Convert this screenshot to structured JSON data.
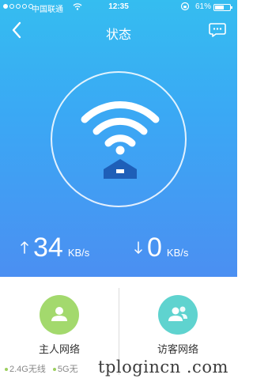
{
  "status_bar": {
    "carrier": "中国联通",
    "time": "12:35",
    "battery": "61%",
    "battery_level": 0.61
  },
  "nav": {
    "title": "状态",
    "back_icon": "chevron-left-icon",
    "chat_icon": "chat-bubble-icon"
  },
  "wifi_status": {
    "icon": "wifi-router-icon"
  },
  "speeds": {
    "upload_value": "34",
    "upload_unit": "KB/s",
    "download_value": "0",
    "download_unit": "KB/s"
  },
  "networks": {
    "main": {
      "label": "主人网络",
      "bands": [
        "2.4G无线",
        "5G无"
      ]
    },
    "guest": {
      "label": "访客网络"
    }
  },
  "watermark": "tplogincn .com",
  "colors": {
    "header_top": "#35bdf0",
    "header_bottom": "#4b8ff2",
    "main_avatar": "#a3d96d",
    "guest_avatar": "#5fd3cf"
  }
}
